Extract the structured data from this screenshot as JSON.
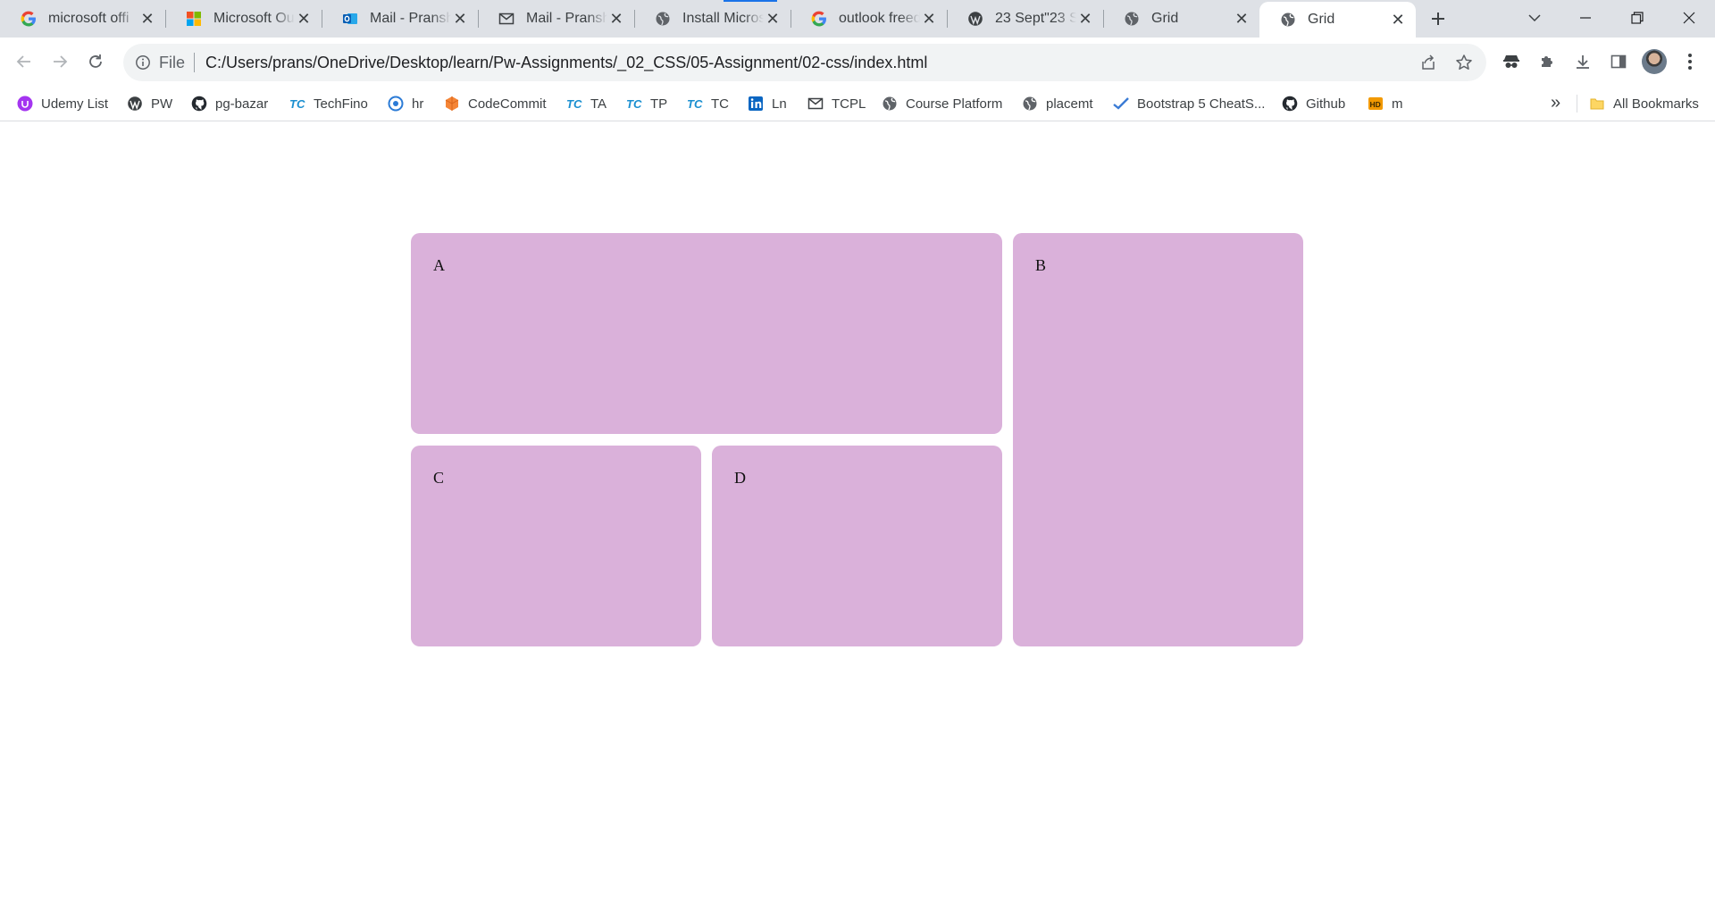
{
  "tabs": [
    {
      "title": "microsoft offi",
      "icon": "google-icon",
      "active": false
    },
    {
      "title": "Microsoft Out",
      "icon": "microsoft-icon",
      "active": false
    },
    {
      "title": "Mail - Pransh",
      "icon": "outlook-icon",
      "active": false
    },
    {
      "title": "Mail - Pransh",
      "icon": "mail-icon",
      "active": false
    },
    {
      "title": "Install Micros",
      "icon": "globe-icon",
      "active": false
    },
    {
      "title": "outlook freed",
      "icon": "google-icon",
      "active": false
    },
    {
      "title": "23 Sept\"23 St",
      "icon": "wordpress-icon",
      "active": false
    },
    {
      "title": "Grid",
      "icon": "globe-icon",
      "active": false
    },
    {
      "title": "Grid",
      "icon": "globe-icon",
      "active": true
    }
  ],
  "omnibox": {
    "scheme_label": "File",
    "url": "C:/Users/prans/OneDrive/Desktop/learn/Pw-Assignments/_02_CSS/05-Assignment/02-css/index.html"
  },
  "bookmarks": [
    {
      "label": "Udemy List",
      "icon": "udemy-icon"
    },
    {
      "label": "PW",
      "icon": "wordpress-icon"
    },
    {
      "label": "pg-bazar",
      "icon": "github-icon"
    },
    {
      "label": "TechFino",
      "icon": "tc-icon"
    },
    {
      "label": "hr",
      "icon": "hr-icon"
    },
    {
      "label": "CodeCommit",
      "icon": "codecommit-icon"
    },
    {
      "label": "TA",
      "icon": "tc-icon"
    },
    {
      "label": "TP",
      "icon": "tc-icon"
    },
    {
      "label": "TC",
      "icon": "tc-icon"
    },
    {
      "label": "Ln",
      "icon": "linkedin-icon"
    },
    {
      "label": "TCPL",
      "icon": "mail-icon"
    },
    {
      "label": "Course Platform",
      "icon": "globe-icon"
    },
    {
      "label": "placemt",
      "icon": "globe-icon"
    },
    {
      "label": "Bootstrap 5 CheatS...",
      "icon": "check-icon"
    },
    {
      "label": "Github",
      "icon": "github-icon"
    },
    {
      "label": "m",
      "icon": "hd-icon"
    }
  ],
  "bookmarks_more": "»",
  "all_bookmarks_label": "All Bookmarks",
  "grid": {
    "a": "A",
    "b": "B",
    "c": "C",
    "d": "D",
    "cell_color": "#dab1da"
  },
  "colors": {
    "tab_strip": "#dee1e6",
    "omnibox": "#f1f3f4",
    "accent": "#1a73e8"
  }
}
